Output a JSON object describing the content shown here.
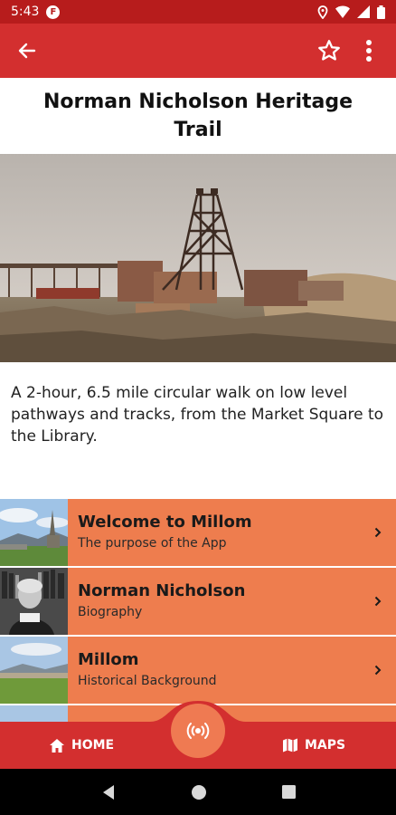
{
  "status_bar": {
    "time": "5:43",
    "app_badge": "F"
  },
  "page": {
    "title": "Norman Nicholson Heritage Trail",
    "intro": "A 2-hour, 6.5 mile circular walk on low level pathways and tracks, from the Market Square to the Library."
  },
  "list": [
    {
      "title": "Welcome to Millom",
      "subtitle": "The purpose of the App"
    },
    {
      "title": "Norman Nicholson",
      "subtitle": "Biography"
    },
    {
      "title": "Millom",
      "subtitle": "Historical Background"
    }
  ],
  "bottom_nav": {
    "home": "HOME",
    "maps": "MAPS"
  },
  "colors": {
    "status_bar": "#b71c1c",
    "app_bar": "#d32f2f",
    "list_item": "#ee7d4e",
    "fab": "#ef7a52"
  }
}
